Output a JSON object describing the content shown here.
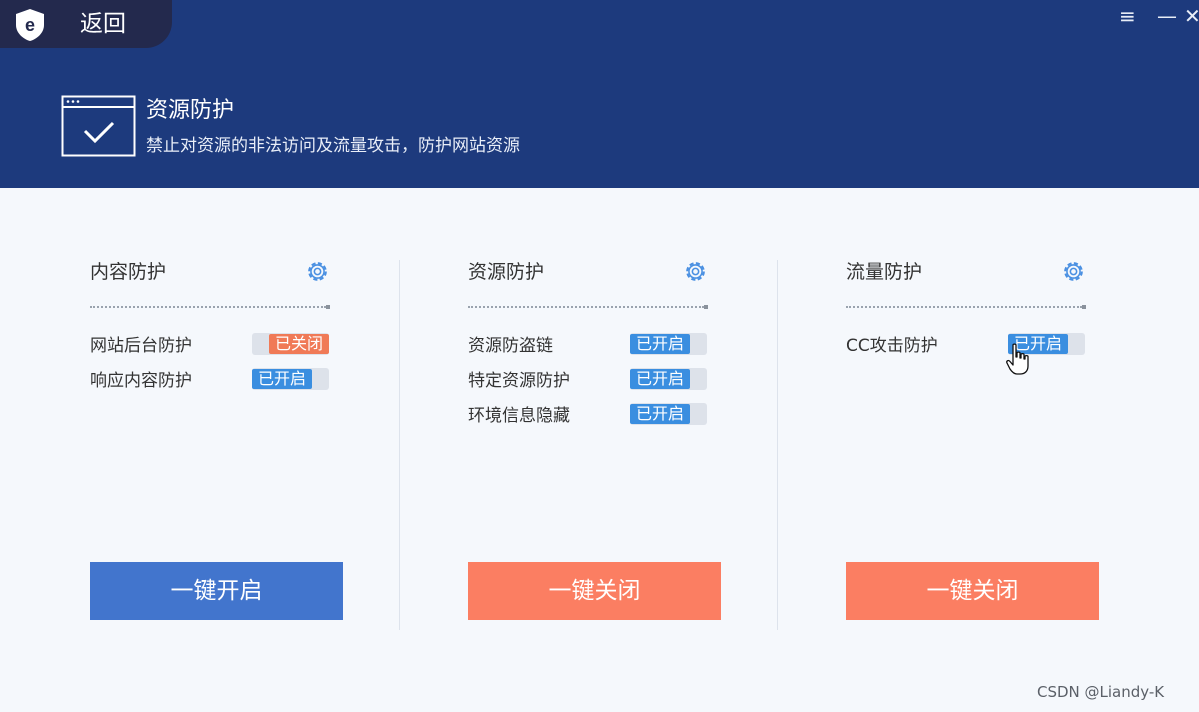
{
  "titlebar": {
    "back_label": "返回",
    "menu_glyph": "≡",
    "minimize_glyph": "—",
    "close_glyph": "✕"
  },
  "header": {
    "title": "资源防护",
    "description": "禁止对资源的非法访问及流量攻击，防护网站资源"
  },
  "cards": [
    {
      "title": "内容防护",
      "items": [
        {
          "label": "网站后台防护",
          "state": "已关闭"
        },
        {
          "label": "响应内容防护",
          "state": "已开启"
        }
      ],
      "action": "一键开启"
    },
    {
      "title": "资源防护",
      "items": [
        {
          "label": "资源防盗链",
          "state": "已开启"
        },
        {
          "label": "特定资源防护",
          "state": "已开启"
        },
        {
          "label": "环境信息隐藏",
          "state": "已开启"
        }
      ],
      "action": "一键关闭"
    },
    {
      "title": "流量防护",
      "items": [
        {
          "label": "CC攻击防护",
          "state": "已开启"
        }
      ],
      "action": "一键关闭"
    }
  ],
  "watermark": "CSDN @Liandy-K",
  "colors": {
    "header_bg": "#1d3a7d",
    "toggle_on": "#3a8ee0",
    "toggle_off": "#f07a57",
    "button_blue": "#4275cd",
    "button_orange": "#fb7e62"
  },
  "icons": [
    "app-logo-icon",
    "window-check-icon",
    "gear-icon",
    "hand-cursor-icon"
  ]
}
